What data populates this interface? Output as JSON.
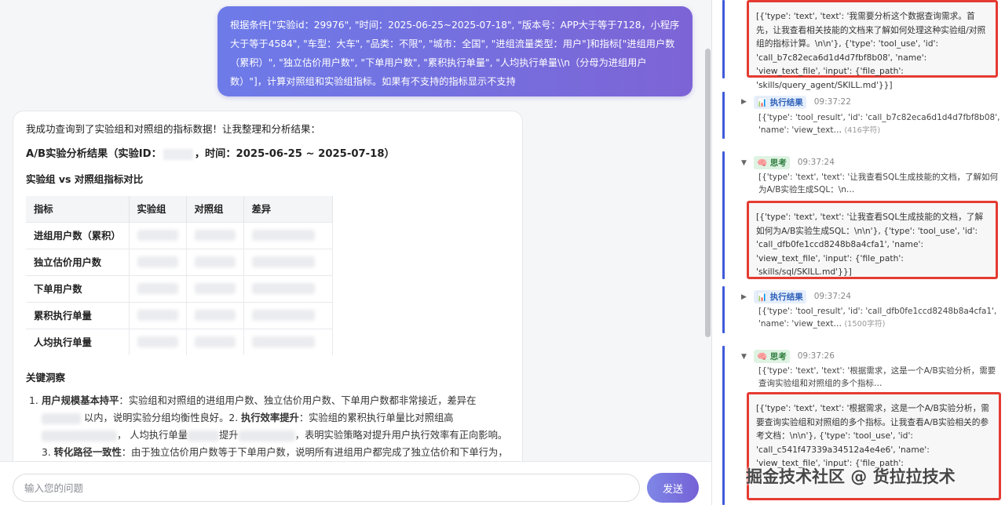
{
  "user_message": "根据条件[\"实验id：29976\", \"时间：2025-06-25~2025-07-18\", \"版本号：APP大于等于7128，小程序大于等于4584\", \"车型：大车\", \"品类：不限\", \"城市：全国\", \"进组流量类型：用户\"]和指标[\"进组用户数（累积）\", \"独立估价用户数\", \"下单用户数\", \"累积执行单量\", \"人均执行单量\\\\n（分母为进组用户数）\"]，计算对照组和实验组指标。如果有不支持的指标显示不支持",
  "assistant": {
    "intro": "我成功查询到了实验组和对照组的指标数据！让我整理和分析结果：",
    "result_title_prefix": "A/B实验分析结果（实验ID：",
    "result_title_suffix": "，时间：2025-06-25 ~ 2025-07-18）",
    "table_heading": "实验组 vs 对照组指标对比",
    "table_headers": [
      "指标",
      "实验组",
      "对照组",
      "差异"
    ],
    "table_rows": [
      "进组用户数（累积）",
      "独立估价用户数",
      "下单用户数",
      "累积执行单量",
      "人均执行单量"
    ],
    "insights_heading": "关键洞察",
    "insight_number": "1.",
    "insight_part1_bold": "用户规模基本持平",
    "insight_part1": "：实验组和对照组的进组用户数、独立估价用户数、下单用户数都非常接近，差异在",
    "insight_part2": "以内，说明实验分组均衡性良好。2.",
    "insight_part2_bold": "执行效率提升",
    "insight_part3": "：实验组的累积执行单量比对照组高",
    "insight_part4": "，",
    "insight_part5": "人均执行单量",
    "insight_part6": "提升",
    "insight_part7": "，表明实验策略对提升用户执行效率有正向影响。3.",
    "insight_part7_bold": "转化路径一致性",
    "insight_part8": "：由于独立估价用户数等于下单用户数，说明所有进组用户都完成了独立估价和下单行为，转化路径非常"
  },
  "input": {
    "placeholder": "输入您的问题",
    "send_label": "发送"
  },
  "log": {
    "box1": "[{'type': 'text', 'text': '我需要分析这个数据查询需求。首先，让我查看相关技能的文档来了解如何处理这种实验组/对照组的指标计算。\\n\\n'}, {'type': 'tool_use', 'id': 'call_b7c82eca6d1d4d7fbf8b08', 'name': 'view_text_file', 'input': {'file_path': 'skills/query_agent/SKILL.md'}}]",
    "entries": [
      {
        "caret": "▶",
        "icon": "📊",
        "tag": "执行结果",
        "time": "09:37:22",
        "summary": "[{'type': 'tool_result', 'id': 'call_b7c82eca6d1d4d7fbf8b08', 'name': 'view_text…",
        "count": "(416字符)"
      },
      {
        "caret": "▼",
        "icon": "🧠",
        "tag": "思考",
        "time": "09:37:24",
        "summary": "[{'type': 'text', 'text': '让我查看SQL生成技能的文档，了解如何为A/B实验生成SQL：\\n…"
      },
      {
        "caret": "▶",
        "icon": "📊",
        "tag": "执行结果",
        "time": "09:37:24",
        "summary": "[{'type': 'tool_result', 'id': 'call_dfb0fe1ccd8248b8a4cfa1', 'name': 'view_text…",
        "count": "(1500字符)"
      },
      {
        "caret": "▼",
        "icon": "🧠",
        "tag": "思考",
        "time": "09:37:26",
        "summary": "[{'type': 'text', 'text': '根据需求，这是一个A/B实验分析，需要查询实验组和对照组的多个指标…"
      }
    ],
    "box2": "[{'type': 'text', 'text': '让我查看SQL生成技能的文档，了解如何为A/B实验生成SQL：\\n\\n'}, {'type': 'tool_use', 'id': 'call_dfb0fe1ccd8248b8a4cfa1', 'name': 'view_text_file', 'input': {'file_path': 'skills/sql/SKILL.md'}}]",
    "box3": "[{'type': 'text', 'text': '根据需求，这是一个A/B实验分析，需要查询实验组和对照组的多个指标。让我查看A/B实验相关的参考文档：\\n\\n'}, {'type': 'tool_use', 'id': 'call_c541f47339a34512a4e4e6', 'name': 'view_text_file', 'input': {'file_path':"
  },
  "watermark": "掘金技术社区 @ 货拉拉技术"
}
